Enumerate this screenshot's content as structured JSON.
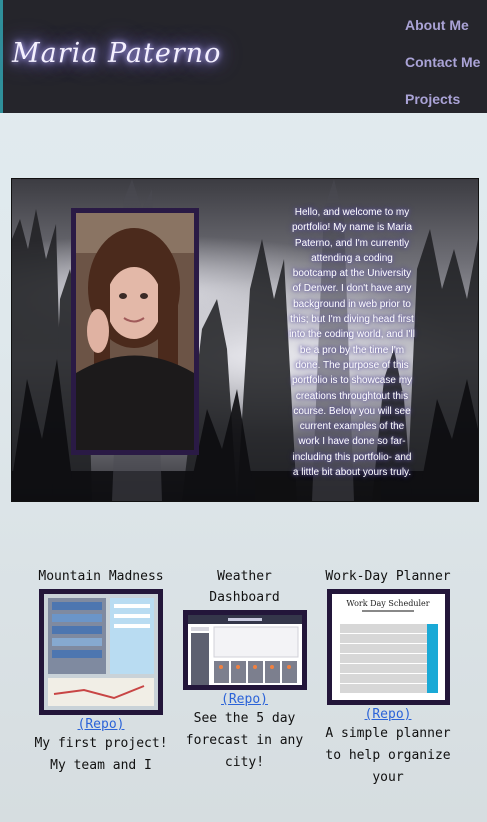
{
  "header": {
    "brand": "Maria Paterno",
    "nav": [
      "About Me",
      "Contact Me",
      "Projects"
    ]
  },
  "about": {
    "intro_text": "Hello, and welcome to my portfolio! My name is Maria Paterno, and I'm currently attending a coding bootcamp at the University of Denver. I don't have any background in web prior to this; but I'm diving head first into the coding world, and I'll be a pro by the time I'm done. The purpose of this portfolio is to showcase my creations throughtout this course. Below you will see current examples of the work I have done so far- including this portfolio- and a little bit about yours truly."
  },
  "projects": [
    {
      "title": "Mountain Madness",
      "repo_label": "(Repo)",
      "description": "My first project! My team and I"
    },
    {
      "title": "Weather Dashboard",
      "repo_label": "(Repo)",
      "description": "See the 5 day forecast in any city!",
      "thumb_header": "Weather Dashboard"
    },
    {
      "title": "Work-Day Planner",
      "repo_label": "(Repo)",
      "description": "A simple planner to help organize your",
      "thumb_header": "Work Day Scheduler"
    }
  ],
  "colors": {
    "header_bg": "#25252b",
    "nav_text": "#aaa3d6",
    "link": "#2b63d8",
    "frame": "#23163a"
  }
}
